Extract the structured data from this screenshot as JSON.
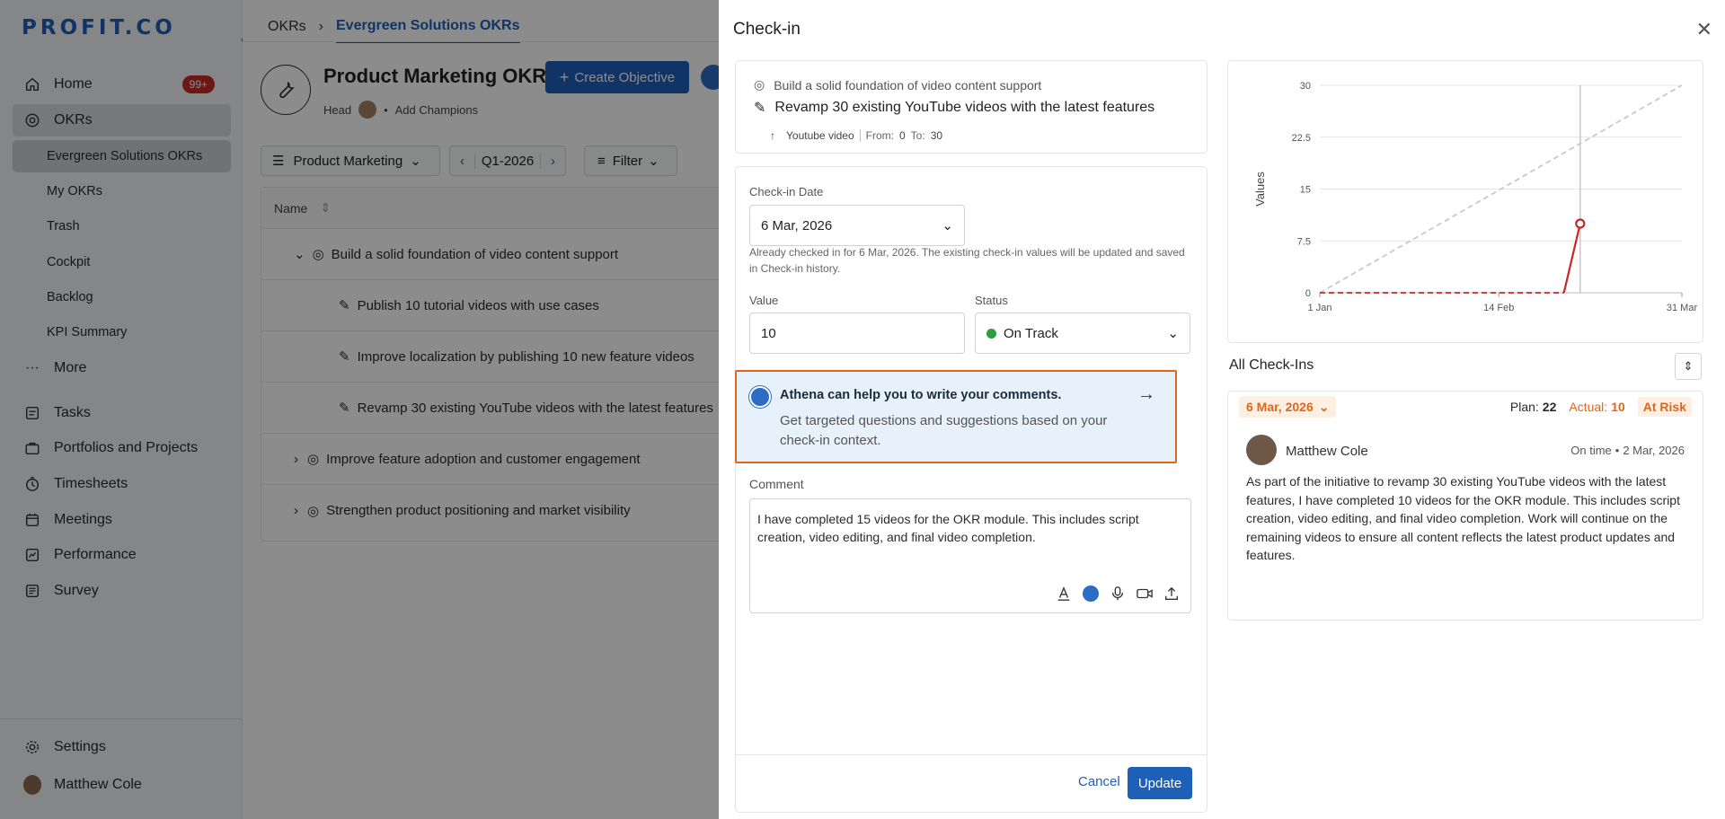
{
  "brand": {
    "logo": "PROFIT.CO",
    "accent": "#1e5fb8",
    "alert": "#c62828"
  },
  "sidebar": {
    "items": [
      {
        "label": "Home",
        "icon": "home-icon",
        "badge": "99+"
      },
      {
        "label": "OKRs",
        "icon": "target-icon"
      },
      {
        "label": "More",
        "icon": "more-dots-icon"
      },
      {
        "label": "Tasks",
        "icon": "tasks-icon"
      },
      {
        "label": "Portfolios and Projects",
        "icon": "briefcase-icon"
      },
      {
        "label": "Timesheets",
        "icon": "clock-icon"
      },
      {
        "label": "Meetings",
        "icon": "calendar-icon"
      },
      {
        "label": "Performance",
        "icon": "chart-icon"
      },
      {
        "label": "Survey",
        "icon": "survey-icon"
      }
    ],
    "okr_subitems": [
      "Evergreen Solutions OKRs",
      "My OKRs",
      "Trash",
      "Cockpit",
      "Backlog",
      "KPI Summary"
    ],
    "settings": "Settings",
    "user": "Matthew Cole"
  },
  "main": {
    "breadcrumbs": [
      "OKRs",
      "Evergreen Solutions OKRs"
    ],
    "title": "Product Marketing OKRs",
    "create_button": "Create Objective",
    "head_label": "Head",
    "add_champions": "Add Champions",
    "team_select": "Product Marketing",
    "period": "Q1-2026",
    "filter": "Filter",
    "column_name": "Name",
    "rows": [
      {
        "label": "Build a solid foundation of video content support",
        "type": "objective",
        "expanded": true
      },
      {
        "label": "Publish 10 tutorial videos with use cases",
        "type": "kr"
      },
      {
        "label": "Improve localization by publishing 10 new feature videos",
        "type": "kr"
      },
      {
        "label": "Revamp 30 existing YouTube videos with the latest features",
        "type": "kr"
      },
      {
        "label": "Improve feature adoption and customer engagement",
        "type": "objective",
        "expanded": false
      },
      {
        "label": "Strengthen product positioning and market visibility",
        "type": "objective",
        "expanded": false
      }
    ]
  },
  "drawer": {
    "title": "Check-in",
    "objective": "Build a solid foundation of video content support",
    "key_result": "Revamp 30 existing YouTube videos with the latest features",
    "metric_unit": "Youtube video",
    "from_label": "From:",
    "from_value": "0",
    "to_label": "To:",
    "to_value": "30",
    "date_label": "Check-in Date",
    "date_value": "6 Mar, 2026",
    "date_note": "Already checked in for 6 Mar, 2026. The existing check-in values will be updated and saved in Check-in history.",
    "value_label": "Value",
    "value": "10",
    "status_label": "Status",
    "status": "On Track",
    "status_color": "#2e9e3e",
    "athena_title": "Athena can help you to write your comments.",
    "athena_text": "Get targeted questions and suggestions based on your check-in context.",
    "comment_label": "Comment",
    "comment": "I have completed 15 videos for the OKR module. This includes script creation, video editing, and final video completion.",
    "comment_tools": [
      "text-format-icon",
      "athena-icon",
      "microphone-icon",
      "video-icon",
      "upload-icon"
    ],
    "cancel": "Cancel",
    "update": "Update"
  },
  "chart_data": {
    "type": "line",
    "ylabel": "Values",
    "xlabel": "",
    "yticks": [
      "0",
      "7.5",
      "15",
      "22.5",
      "30"
    ],
    "xticks": [
      "1 Jan",
      "14 Feb",
      "31 Mar"
    ],
    "ylim": [
      0,
      30
    ],
    "xlim": [
      "2026-01-01",
      "2026-03-31"
    ],
    "today": "2026-03-06",
    "grid": true,
    "series": [
      {
        "style": "dashed",
        "color": "#c9c9c9",
        "points": [
          [
            "2026-01-01",
            0
          ],
          [
            "2026-03-31",
            30
          ]
        ]
      },
      {
        "style": "dashed",
        "color": "#c62828",
        "points": [
          [
            "2026-01-01",
            0
          ],
          [
            "2026-03-02",
            0
          ]
        ]
      },
      {
        "style": "solid",
        "color": "#c62828",
        "points": [
          [
            "2026-03-02",
            0
          ],
          [
            "2026-03-06",
            10
          ]
        ]
      }
    ],
    "marker": {
      "x": "2026-03-06",
      "y": 10
    }
  },
  "checkins": {
    "title": "All Check-Ins",
    "date": "6 Mar, 2026",
    "plan_label": "Plan:",
    "plan": "22",
    "actual_label": "Actual:",
    "actual": "10",
    "status": "At Risk",
    "author": "Matthew Cole",
    "timing": "On time",
    "posted": "2 Mar, 2026",
    "text": "As part of the initiative to revamp 30 existing YouTube videos with the latest features, I have completed 10 videos for the OKR module. This includes script creation, video editing, and final video completion. Work will continue on the remaining videos to ensure all content reflects the latest product updates and features."
  }
}
